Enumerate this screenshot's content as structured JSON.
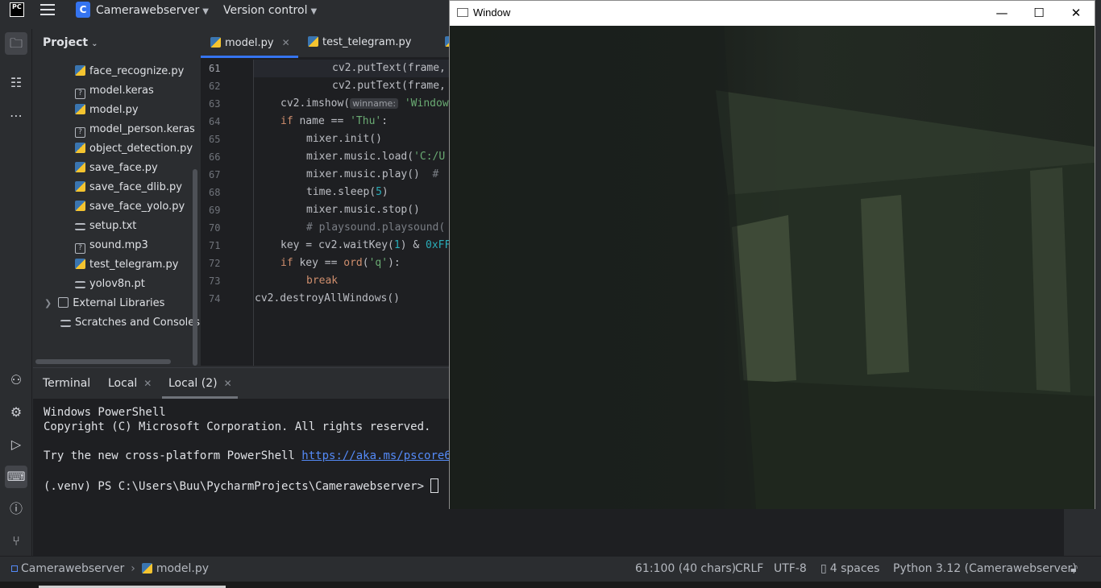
{
  "topbar": {
    "logo": "PC",
    "project_badge": "C",
    "project_name": "Camerawebserver",
    "version_control": "Version control"
  },
  "project_panel": {
    "title": "Project",
    "items": [
      {
        "label": "face_recognize.py",
        "icon": "python-file-icon"
      },
      {
        "label": "model.keras",
        "icon": "unknown-file-icon"
      },
      {
        "label": "model.py",
        "icon": "python-file-icon"
      },
      {
        "label": "model_person.keras",
        "icon": "unknown-file-icon"
      },
      {
        "label": "object_detection.py",
        "icon": "python-file-icon"
      },
      {
        "label": "save_face.py",
        "icon": "python-file-icon"
      },
      {
        "label": "save_face_dlib.py",
        "icon": "python-file-icon"
      },
      {
        "label": "save_face_yolo.py",
        "icon": "python-file-icon"
      },
      {
        "label": "setup.txt",
        "icon": "text-file-icon"
      },
      {
        "label": "sound.mp3",
        "icon": "unknown-file-icon"
      },
      {
        "label": "test_telegram.py",
        "icon": "python-file-icon"
      },
      {
        "label": "yolov8n.pt",
        "icon": "text-file-icon"
      },
      {
        "label": "External Libraries",
        "icon": "library-icon"
      },
      {
        "label": "Scratches and Consoles",
        "icon": "scratches-icon"
      }
    ]
  },
  "editor": {
    "tabs": [
      {
        "label": "model.py",
        "active": true
      },
      {
        "label": "test_telegram.py",
        "active": false
      }
    ],
    "line_numbers": [
      "61",
      "62",
      "63",
      "64",
      "65",
      "66",
      "67",
      "68",
      "69",
      "70",
      "71",
      "72",
      "73",
      "74"
    ],
    "lines": {
      "l61": "cv2.putText(frame,",
      "l62": "cv2.putText(frame,",
      "l63a": "cv2.imshow(",
      "l63hint": "winname:",
      "l63b": "'Window",
      "l64a": "if",
      "l64b": " name == ",
      "l64c": "'Thu'",
      "l64d": ":",
      "l65": "mixer.init()",
      "l66a": "mixer.music.load(",
      "l66b": "'C:/U",
      "l67a": "mixer.music.play()",
      "l67b": "  # ",
      "l68a": "time.sleep(",
      "l68b": "5",
      "l68c": ")",
      "l69": "mixer.music.stop()",
      "l70": "# playsound.playsound(",
      "l71a": "key = cv2.waitKey(",
      "l71b": "1",
      "l71c": ") & ",
      "l71d": "0xFF",
      "l72a": "if",
      "l72b": " key == ",
      "l72c": "ord",
      "l72d": "(",
      "l72e": "'q'",
      "l72f": "):",
      "l73": "break",
      "l74": "cv2.destroyAllWindows()"
    }
  },
  "terminal": {
    "tabs": [
      {
        "label": "Terminal"
      },
      {
        "label": "Local"
      },
      {
        "label": "Local (2)"
      }
    ],
    "line1": "Windows PowerShell",
    "line2": "Copyright (C) Microsoft Corporation. All rights reserved.",
    "line3_prefix": "Try the new cross-platform PowerShell ",
    "line3_link": "https://aka.ms/pscore6",
    "prompt": "(.venv) PS C:\\Users\\Buu\\PycharmProjects\\Camerawebserver> "
  },
  "statusbar": {
    "breadcrumb_project": "Camerawebserver",
    "breadcrumb_file": "model.py",
    "position": "61:100 (40 chars)",
    "line_sep": "CRLF",
    "encoding": "UTF-8",
    "indent": "4 spaces",
    "interpreter": "Python 3.12 (Camerawebserver)"
  },
  "cv_window": {
    "title": "Window",
    "minimize": "—",
    "maximize": "☐",
    "close": "✕"
  }
}
